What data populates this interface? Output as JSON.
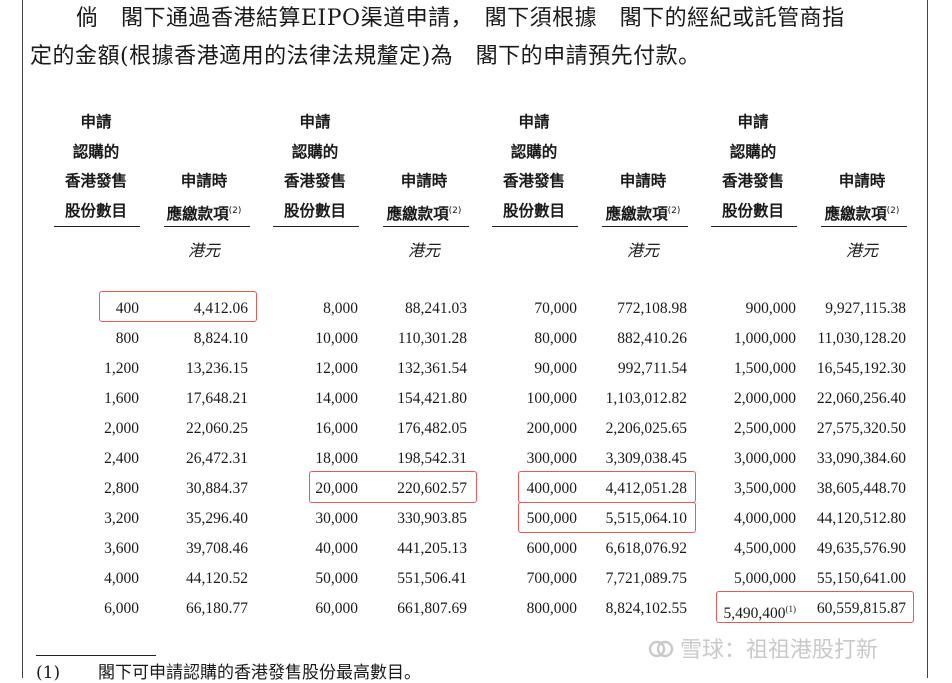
{
  "paragraph": {
    "line1": "倘　閣下通過香港結算EIPO渠道申請，　閣下須根據　閣下的經紀或託管商指",
    "line2": "定的金額(根據香港適用的法律法規釐定)為　閣下的申請預先付款。"
  },
  "headers": {
    "shares_lines": [
      "申請",
      "認購的",
      "香港發售",
      "股份數目"
    ],
    "amount_lines": [
      "申請時",
      "應繳款項"
    ],
    "amount_note": "(2)",
    "unit": "港元"
  },
  "table": {
    "groups": [
      {
        "shares": [
          "400",
          "800",
          "1,200",
          "1,600",
          "2,000",
          "2,400",
          "2,800",
          "3,200",
          "3,600",
          "4,000",
          "6,000"
        ],
        "amounts": [
          "4,412.06",
          "8,824.10",
          "13,236.15",
          "17,648.21",
          "22,060.25",
          "26,472.31",
          "30,884.37",
          "35,296.40",
          "39,708.46",
          "44,120.52",
          "66,180.77"
        ]
      },
      {
        "shares": [
          "8,000",
          "10,000",
          "12,000",
          "14,000",
          "16,000",
          "18,000",
          "20,000",
          "30,000",
          "40,000",
          "50,000",
          "60,000"
        ],
        "amounts": [
          "88,241.03",
          "110,301.28",
          "132,361.54",
          "154,421.80",
          "176,482.05",
          "198,542.31",
          "220,602.57",
          "330,903.85",
          "441,205.13",
          "551,506.41",
          "661,807.69"
        ]
      },
      {
        "shares": [
          "70,000",
          "80,000",
          "90,000",
          "100,000",
          "200,000",
          "300,000",
          "400,000",
          "500,000",
          "600,000",
          "700,000",
          "800,000"
        ],
        "amounts": [
          "772,108.98",
          "882,410.26",
          "992,711.54",
          "1,103,012.82",
          "2,206,025.65",
          "3,309,038.45",
          "4,412,051.28",
          "5,515,064.10",
          "6,618,076.92",
          "7,721,089.75",
          "8,824,102.55"
        ]
      },
      {
        "shares": [
          "900,000",
          "1,000,000",
          "1,500,000",
          "2,000,000",
          "2,500,000",
          "3,000,000",
          "3,500,000",
          "4,000,000",
          "4,500,000",
          "5,000,000",
          "5,490,400"
        ],
        "amounts": [
          "9,927,115.38",
          "11,030,128.20",
          "16,545,192.30",
          "22,060,256.40",
          "27,575,320.50",
          "33,090,384.60",
          "38,605,448.70",
          "44,120,512.80",
          "49,635,576.90",
          "55,150,641.00",
          "60,559,815.87"
        ]
      }
    ],
    "last_share_note": "(1)"
  },
  "highlight_color": "#e85a5a",
  "footnote": {
    "number": "(1)",
    "text": "閣下可申請認購的香港發售股份最高數目。"
  },
  "watermark": {
    "icon": "snowball-logo-icon",
    "text": "雪球：祖祖港股打新"
  }
}
